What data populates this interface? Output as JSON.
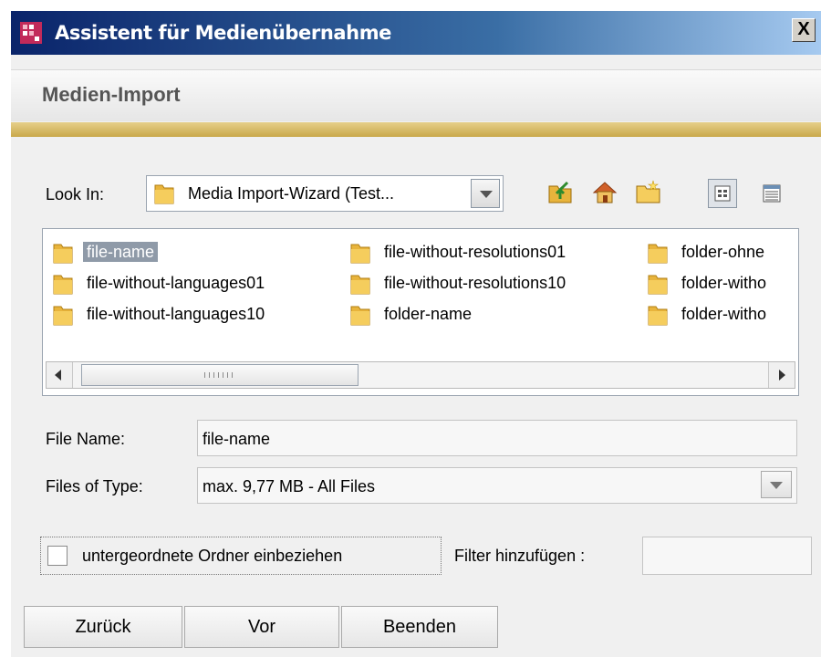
{
  "window": {
    "title": "Assistent für Medienübernahme",
    "close_label": "X"
  },
  "header": {
    "title": "Medien-Import"
  },
  "lookin": {
    "label": "Look In:",
    "value": "Media Import-Wizard (Test...",
    "tools": [
      {
        "name": "up-folder-icon"
      },
      {
        "name": "home-icon"
      },
      {
        "name": "new-folder-icon"
      }
    ],
    "views": [
      {
        "name": "list-view-icon",
        "active": true
      },
      {
        "name": "details-view-icon",
        "active": false
      }
    ]
  },
  "files": [
    {
      "name": "file-name",
      "selected": true
    },
    {
      "name": "file-without-languages01"
    },
    {
      "name": "file-without-languages10"
    },
    {
      "name": "file-without-resolutions01"
    },
    {
      "name": "file-without-resolutions10"
    },
    {
      "name": "folder-name"
    },
    {
      "name": "folder-ohne"
    },
    {
      "name": "folder-witho"
    },
    {
      "name": "folder-witho"
    }
  ],
  "filename": {
    "label": "File Name:",
    "value": "file-name"
  },
  "filetype": {
    "label": "Files of Type:",
    "value": "max. 9,77 MB - All Files"
  },
  "subfolders": {
    "label": "untergeordnete Ordner einbeziehen",
    "checked": false
  },
  "filter": {
    "label": "Filter hinzufügen :",
    "value": ""
  },
  "buttons": {
    "back": "Zurück",
    "next": "Vor",
    "finish": "Beenden"
  },
  "colors": {
    "title_start": "#0a246a",
    "title_end": "#a6caf0",
    "accent_bar": "#c9a84a",
    "selection": "#8f9aa8",
    "folder": "#e8b43c"
  }
}
